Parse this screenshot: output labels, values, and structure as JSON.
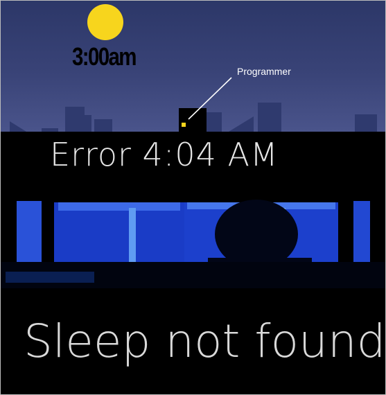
{
  "top_panel": {
    "time_caption": "3:00am",
    "pointer_label": "Programmer",
    "sky_color": "#333d70",
    "sun_color": "#f7d51d",
    "window_light_color": "#f7d51d",
    "building_color": "#2f3a6e"
  },
  "error_panel": {
    "title": "Error 4:04 AM",
    "screen_color": "#1b3fd1"
  },
  "caption": {
    "text": "Sleep not found"
  }
}
